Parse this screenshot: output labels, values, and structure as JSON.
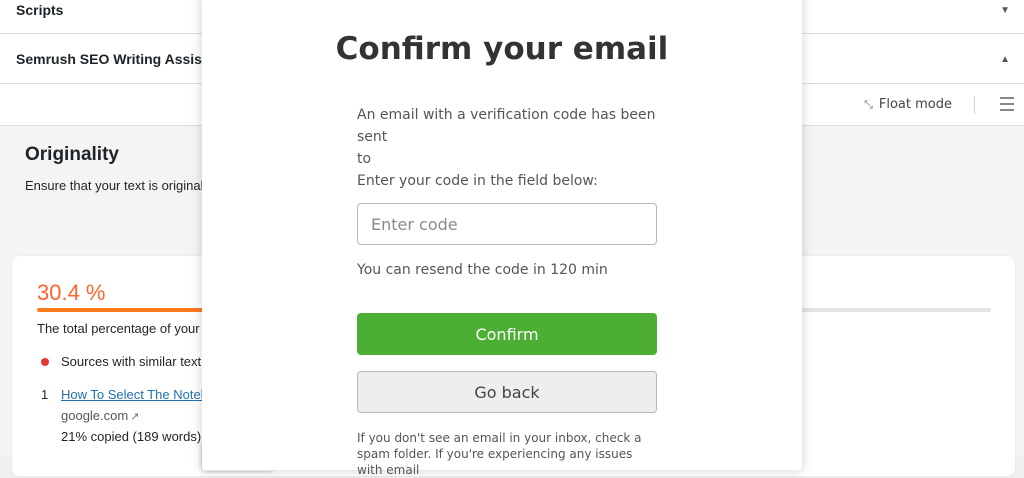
{
  "panels": {
    "scripts_title": "Scripts",
    "semrush_title": "Semrush SEO Writing Assist",
    "caret_down": "▼",
    "caret_up": "▲"
  },
  "toolbar": {
    "float_mode_label": "Float mode",
    "float_icon": "compress-arrows-icon",
    "menu_icon": "hamburger-menu-icon"
  },
  "originality": {
    "title": "Originality",
    "subtitle": "Ensure that your text is original",
    "percentage_text": "30.4 %",
    "percentage_value": 30.4,
    "total_text": "The total percentage of your",
    "sources_text": "Sources with similar text",
    "result": {
      "number": "1",
      "link": "How To Select The Notel",
      "domain": "google.com",
      "copied": "21% copied (189 words)"
    },
    "accent_color": "#ff642d"
  },
  "modal": {
    "title": "Confirm your email",
    "desc_line1": "An email with a verification code has been sent",
    "desc_line2": "to",
    "desc_line3": "Enter your code in the field below:",
    "input_placeholder": "Enter code",
    "input_value": "",
    "resend_text": "You can resend the code in 120 min",
    "confirm_label": "Confirm",
    "back_label": "Go back",
    "footer_text": "If you don't see an email in your inbox, check a spam folder. If you're experiencing any issues with email",
    "confirm_color": "#4cae32"
  }
}
